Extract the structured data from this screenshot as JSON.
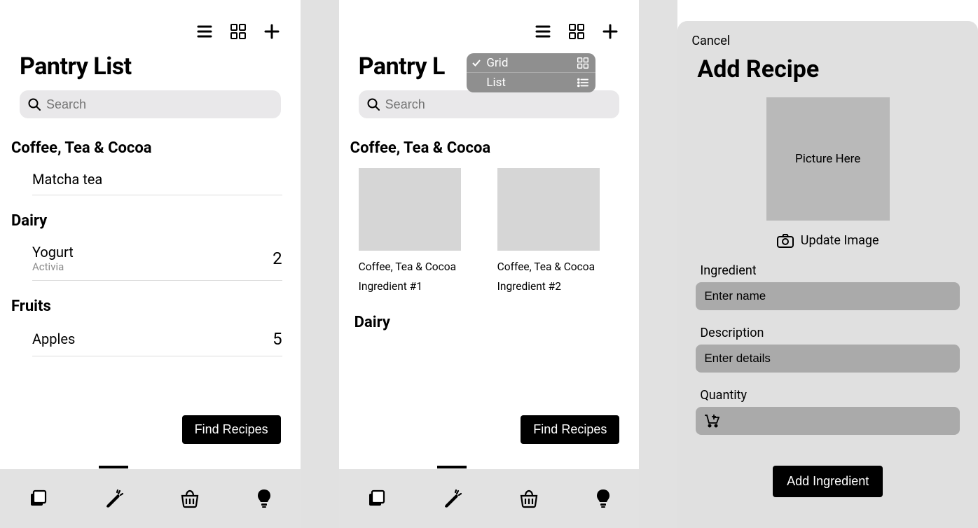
{
  "screen1": {
    "title": "Pantry List",
    "search_placeholder": "Search",
    "categories": [
      {
        "name": "Coffee, Tea & Cocoa",
        "items": [
          {
            "name": "Matcha tea",
            "sub": "",
            "qty": ""
          }
        ]
      },
      {
        "name": "Dairy",
        "items": [
          {
            "name": "Yogurt",
            "sub": "Activia",
            "qty": "2"
          }
        ]
      },
      {
        "name": "Fruits",
        "items": [
          {
            "name": "Apples",
            "sub": "",
            "qty": "5"
          }
        ]
      }
    ],
    "find_recipes": "Find Recipes"
  },
  "screen2": {
    "title": "Pantry L",
    "search_placeholder": "Search",
    "menu": {
      "opt_grid": "Grid",
      "opt_list": "List"
    },
    "cat1": "Coffee, Tea & Cocoa",
    "grid": [
      {
        "cat": "Coffee, Tea & Cocoa",
        "name": "Ingredient #1"
      },
      {
        "cat": "Coffee, Tea & Cocoa",
        "name": "Ingredient #2"
      }
    ],
    "cat2": "Dairy",
    "find_recipes": "Find Recipes"
  },
  "screen3": {
    "cancel": "Cancel",
    "title": "Add Recipe",
    "picture_placeholder": "Picture Here",
    "update_image": "Update Image",
    "fields": {
      "ingredient_label": "Ingredient",
      "ingredient_placeholder": "Enter name",
      "description_label": "Description",
      "description_placeholder": "Enter details",
      "quantity_label": "Quantity"
    },
    "add_ingredient": "Add Ingredient"
  }
}
